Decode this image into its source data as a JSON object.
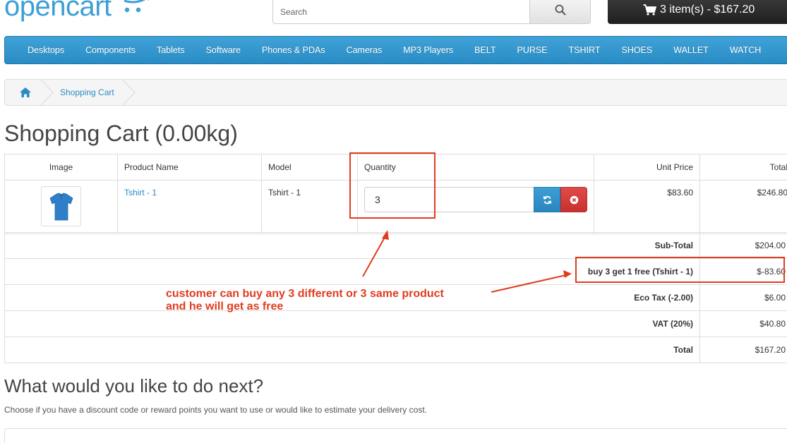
{
  "header": {
    "logo_text": "opencart",
    "search_placeholder": "Search",
    "cart_summary": "3 item(s) - $167.20"
  },
  "menu": [
    "Desktops",
    "Components",
    "Tablets",
    "Software",
    "Phones & PDAs",
    "Cameras",
    "MP3 Players",
    "BELT",
    "PURSE",
    "TSHIRT",
    "SHOES",
    "WALLET",
    "WATCH"
  ],
  "breadcrumb": {
    "current": "Shopping Cart"
  },
  "page_title": "Shopping Cart (0.00kg)",
  "cart": {
    "headers": {
      "image": "Image",
      "name": "Product Name",
      "model": "Model",
      "quantity": "Quantity",
      "unit_price": "Unit Price",
      "total": "Total"
    },
    "items": [
      {
        "name": "Tshirt - 1",
        "model": "Tshirt - 1",
        "quantity": "3",
        "unit_price": "$83.60",
        "total": "$246.80"
      }
    ]
  },
  "totals": [
    {
      "label": "Sub-Total",
      "value": "$204.00"
    },
    {
      "label": "buy 3 get 1 free (Tshirt - 1)",
      "value": "$-83.60"
    },
    {
      "label": "Eco Tax (-2.00)",
      "value": "$6.00"
    },
    {
      "label": "VAT (20%)",
      "value": "$40.80"
    },
    {
      "label": "Total",
      "value": "$167.20"
    }
  ],
  "next": {
    "title": "What would you like to do next?",
    "description": "Choose if you have a discount code or reward points you want to use or would like to estimate your delivery cost."
  },
  "annotation": {
    "line1": "customer can buy any 3 different or 3 same product",
    "line2": "and he will get as free",
    "color": "#e03c1f"
  },
  "colors": {
    "brand": "#3d9fd6",
    "menu": "#2a8cc4",
    "remove": "#c73230"
  }
}
